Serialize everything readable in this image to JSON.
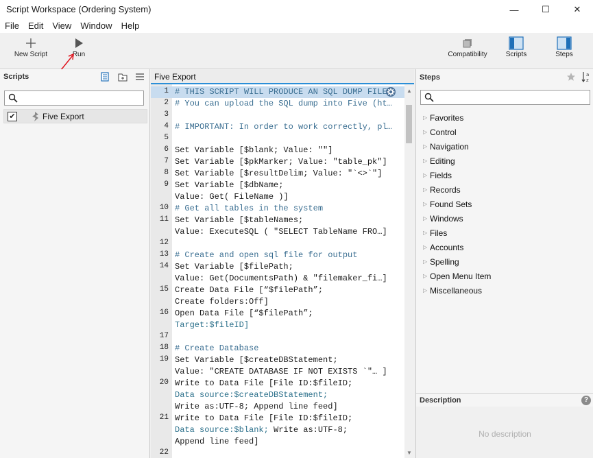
{
  "window": {
    "title": "Script Workspace (Ordering System)",
    "minimize": "—",
    "maximize": "☐",
    "close": "✕"
  },
  "menu": [
    "File",
    "Edit",
    "View",
    "Window",
    "Help"
  ],
  "toolbar": {
    "new_script": "New Script",
    "run": "Run",
    "compatibility": "Compatibility",
    "scripts": "Scripts",
    "steps": "Steps"
  },
  "scripts_pane": {
    "title": "Scripts",
    "search_value": "",
    "items": [
      {
        "name": "Five Export",
        "checked": true
      }
    ]
  },
  "editor": {
    "tab": "Five Export",
    "lines": [
      {
        "num": "1",
        "text": "# THIS SCRIPT WILL PRODUCE AN SQL DUMP FILE…",
        "kind": "comment",
        "selected": true
      },
      {
        "num": "2",
        "text": "# You can upload the SQL dump into Five (ht…",
        "kind": "comment"
      },
      {
        "num": "3",
        "text": "",
        "kind": "plain"
      },
      {
        "num": "4",
        "text": "# IMPORTANT: In order to work correctly, pl…",
        "kind": "comment"
      },
      {
        "num": "5",
        "text": "",
        "kind": "plain"
      },
      {
        "num": "6",
        "text": "Set Variable [$blank; Value: \"\"]",
        "kind": "plain"
      },
      {
        "num": "7",
        "text": "Set Variable [$pkMarker; Value: \"table_pk\"]",
        "kind": "plain"
      },
      {
        "num": "8",
        "text": "Set Variable [$resultDelim; Value: \"`<>`\"]",
        "kind": "plain"
      },
      {
        "num": "9",
        "text": "Set Variable [$dbName;",
        "kind": "plain"
      },
      {
        "num": "",
        "text": "Value: Get( FileName )]",
        "kind": "plain"
      },
      {
        "num": "10",
        "text": "# Get all tables in the system",
        "kind": "comment"
      },
      {
        "num": "11",
        "text": "Set Variable [$tableNames;",
        "kind": "plain"
      },
      {
        "num": "",
        "text": "Value: ExecuteSQL ( \"SELECT TableName FRO…]",
        "kind": "plain"
      },
      {
        "num": "12",
        "text": "",
        "kind": "plain"
      },
      {
        "num": "13",
        "text": "# Create and open sql file for output",
        "kind": "comment"
      },
      {
        "num": "14",
        "text": "Set Variable [$filePath;",
        "kind": "plain"
      },
      {
        "num": "",
        "text": "Value: Get(DocumentsPath) & \"filemaker_fi…]",
        "kind": "plain"
      },
      {
        "num": "15",
        "text": "Create Data File [“$filePath”;",
        "kind": "plain"
      },
      {
        "num": "",
        "text": "Create folders:Off]",
        "kind": "plain"
      },
      {
        "num": "16",
        "text": "Open Data File [“$filePath”;",
        "kind": "plain"
      },
      {
        "num": "",
        "text": "Target:$fileID]",
        "kind": "param"
      },
      {
        "num": "17",
        "text": "",
        "kind": "plain"
      },
      {
        "num": "18",
        "text": "# Create Database",
        "kind": "comment"
      },
      {
        "num": "19",
        "text": "Set Variable [$createDBStatement;",
        "kind": "plain"
      },
      {
        "num": "",
        "text": "Value: \"CREATE DATABASE IF NOT EXISTS `\"… ]",
        "kind": "plain"
      },
      {
        "num": "20",
        "text": "Write to Data File [File ID:$fileID;",
        "kind": "plain"
      },
      {
        "num": "",
        "text": "Data source:$createDBStatement;",
        "kind": "param"
      },
      {
        "num": "",
        "text": "Write as:UTF-8; Append line feed]",
        "kind": "plain"
      },
      {
        "num": "21",
        "text": "Write to Data File [File ID:$fileID;",
        "kind": "plain"
      },
      {
        "num": "",
        "text": "Data source:$blank; Write as:UTF-8;",
        "kind": "mixed",
        "param_part": "Data source:$blank;",
        "plain_part": " Write as:UTF-8;"
      },
      {
        "num": "",
        "text": "Append line feed]",
        "kind": "plain"
      },
      {
        "num": "22",
        "text": "",
        "kind": "plain"
      }
    ]
  },
  "steps_pane": {
    "title": "Steps",
    "search_value": "",
    "categories": [
      "Favorites",
      "Control",
      "Navigation",
      "Editing",
      "Fields",
      "Records",
      "Found Sets",
      "Windows",
      "Files",
      "Accounts",
      "Spelling",
      "Open Menu Item",
      "Miscellaneous"
    ],
    "description_title": "Description",
    "description_text": "No description",
    "help_glyph": "?"
  },
  "colors": {
    "accent": "#2b8fd8",
    "selected_line": "#c8dcef",
    "comment": "#3a6e91",
    "annotation_arrow": "#e0141e"
  }
}
